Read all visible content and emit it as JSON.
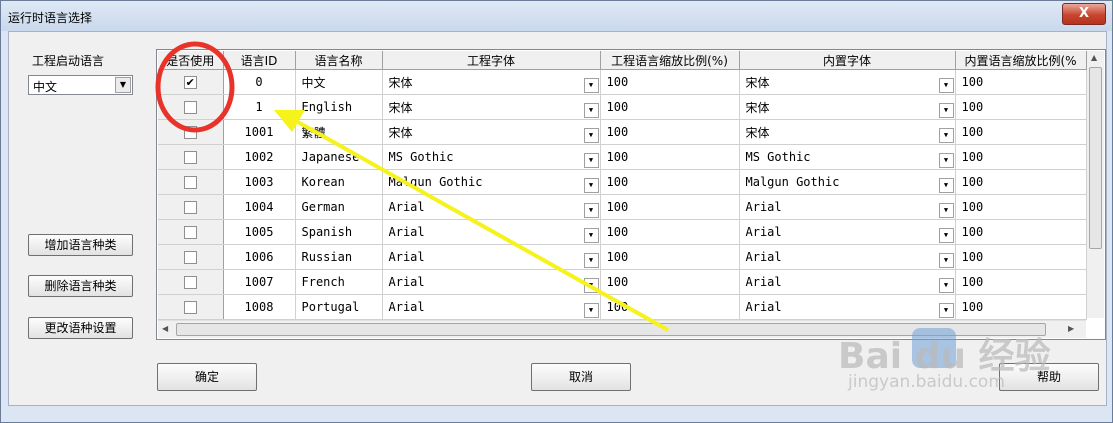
{
  "window": {
    "title": "运行时语言选择",
    "close_label": "X"
  },
  "left": {
    "startup_label": "工程启动语言",
    "startup_value": "中文",
    "buttons": {
      "add": "增加语言种类",
      "delete": "删除语言种类",
      "change": "更改语种设置"
    }
  },
  "columns": [
    "是否使用",
    "语言ID",
    "语言名称",
    "工程字体",
    "工程语言缩放比例(%)",
    "内置字体",
    "内置语言缩放比例(%"
  ],
  "rows": [
    {
      "checked": true,
      "id": "0",
      "name": "中文",
      "font": "宋体",
      "scale": "100",
      "builtin_font": "宋体",
      "builtin_scale": "100"
    },
    {
      "checked": false,
      "id": "1",
      "name": "English",
      "font": "宋体",
      "scale": "100",
      "builtin_font": "宋体",
      "builtin_scale": "100"
    },
    {
      "checked": false,
      "id": "1001",
      "name": "繁體",
      "font": "宋体",
      "scale": "100",
      "builtin_font": "宋体",
      "builtin_scale": "100"
    },
    {
      "checked": false,
      "id": "1002",
      "name": "Japanese",
      "font": "MS Gothic",
      "scale": "100",
      "builtin_font": "MS Gothic",
      "builtin_scale": "100"
    },
    {
      "checked": false,
      "id": "1003",
      "name": "Korean",
      "font": "Malgun Gothic",
      "scale": "100",
      "builtin_font": "Malgun Gothic",
      "builtin_scale": "100"
    },
    {
      "checked": false,
      "id": "1004",
      "name": "German",
      "font": "Arial",
      "scale": "100",
      "builtin_font": "Arial",
      "builtin_scale": "100"
    },
    {
      "checked": false,
      "id": "1005",
      "name": "Spanish",
      "font": "Arial",
      "scale": "100",
      "builtin_font": "Arial",
      "builtin_scale": "100"
    },
    {
      "checked": false,
      "id": "1006",
      "name": "Russian",
      "font": "Arial",
      "scale": "100",
      "builtin_font": "Arial",
      "builtin_scale": "100"
    },
    {
      "checked": false,
      "id": "1007",
      "name": "French",
      "font": "Arial",
      "scale": "100",
      "builtin_font": "Arial",
      "builtin_scale": "100"
    },
    {
      "checked": false,
      "id": "1008",
      "name": "Portugal",
      "font": "Arial",
      "scale": "100",
      "builtin_font": "Arial",
      "builtin_scale": "100"
    }
  ],
  "footer": {
    "ok": "确定",
    "cancel": "取消",
    "help": "帮助"
  },
  "watermark": {
    "brand": "Bai du 经验",
    "url": "jingyan.baidu.com"
  },
  "colors": {
    "annotation_red": "#e8332b",
    "annotation_yellow": "#f6f21c"
  }
}
